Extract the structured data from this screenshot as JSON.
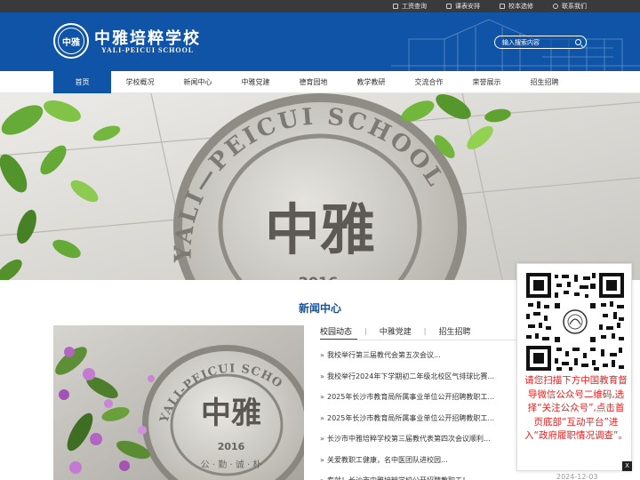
{
  "topbar": {
    "links": [
      {
        "label": "工资查询",
        "icon": "document-icon"
      },
      {
        "label": "课表安排",
        "icon": "calendar-icon"
      },
      {
        "label": "校本选修",
        "icon": "clipboard-icon"
      },
      {
        "label": "联系我们",
        "icon": "phone-icon"
      }
    ]
  },
  "header": {
    "logo_seal_text": "中雅",
    "school_name_cn": "中雅培粹学校",
    "school_name_en": "YALI-PEICUI SCHOOL",
    "search_placeholder": "输入搜索内容",
    "accent_color": "#0f54a6"
  },
  "nav": {
    "items": [
      {
        "label": "首页",
        "active": true
      },
      {
        "label": "学校概况"
      },
      {
        "label": "新闻中心"
      },
      {
        "label": "中雅党建"
      },
      {
        "label": "德育园地"
      },
      {
        "label": "教学教研"
      },
      {
        "label": "交流合作"
      },
      {
        "label": "荣誉展示"
      },
      {
        "label": "招生招聘"
      }
    ]
  },
  "banner": {
    "arc_text": "YALI—PEICUI SCHOOL",
    "emblem_text": "中雅",
    "year": "2016"
  },
  "news_section": {
    "title": "新闻中心",
    "photo": {
      "arc_text": "YALI-PEICUI SCHOOL",
      "emblem_text": "中雅",
      "year": "2016",
      "motto": "公 · 勤 · 诚 · 朴"
    },
    "tabs": [
      "校园动态",
      "中雅党建",
      "招生招聘"
    ],
    "separator": "|",
    "items": [
      "我校举行第三届教代会第五次会议...",
      "我校举行2024年下学期初二年级北校区气排球比赛...",
      "2025年长沙市教育局所属事业单位公开招聘教职工...",
      "2025年长沙市教育局所属事业单位公开招聘教职工...",
      "长沙市中雅培粹学校第三届教代表第四次会议顺利...",
      "关爱教职工健康，名中医团队进校园...",
      "专就！长沙市中雅培粹学校公开招聘教职工！"
    ],
    "last_date": "2024-12-03"
  },
  "qr_panel": {
    "notice": "请您扫描下方中国教育督导微信公众号二维码,选择“关注公众号”,点击首页底部“互动平台”进入“政府履职情况调查”。",
    "close_label": "X"
  }
}
